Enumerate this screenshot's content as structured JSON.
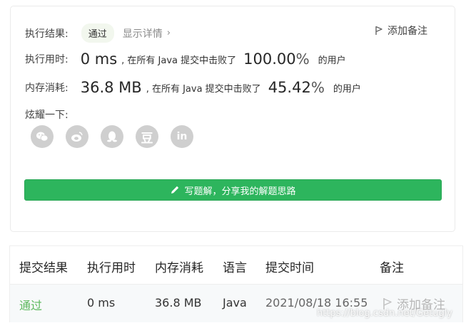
{
  "result": {
    "label": "执行结果:",
    "status": "通过",
    "details_link": "显示详情",
    "add_note": "添加备注"
  },
  "runtime": {
    "label": "执行用时:",
    "value": "0 ms",
    "text_before": ", 在所有 Java 提交中击败了",
    "percent_value": "100.00",
    "percent_sign": "%",
    "text_after": "的用户"
  },
  "memory": {
    "label": "内存消耗:",
    "value": "36.8 MB",
    "text_before": ", 在所有 Java 提交中击败了",
    "percent_value": "45.42",
    "percent_sign": "%",
    "text_after": "的用户"
  },
  "share": {
    "label": "炫耀一下:",
    "icons": [
      "wechat-icon",
      "weibo-icon",
      "qq-icon",
      "douban-icon",
      "linkedin-icon"
    ],
    "douban_glyph": "豆",
    "linkedin_glyph": "in"
  },
  "write_button": {
    "label": "写题解，分享我的解题思路",
    "color": "#2db55d"
  },
  "table": {
    "headers": [
      "提交结果",
      "执行用时",
      "内存消耗",
      "语言",
      "提交时间",
      "备注"
    ],
    "rows": [
      {
        "status": "通过",
        "runtime": "0 ms",
        "memory": "36.8 MB",
        "language": "Java",
        "time": "2021/08/18 16:55",
        "note": "添加备注"
      }
    ]
  },
  "watermark": "https://blog.csdn.net/Getugly",
  "colors": {
    "accepted": "#5cb85c",
    "button_green": "#2db55d",
    "icon_gray": "#cfcfcf"
  }
}
